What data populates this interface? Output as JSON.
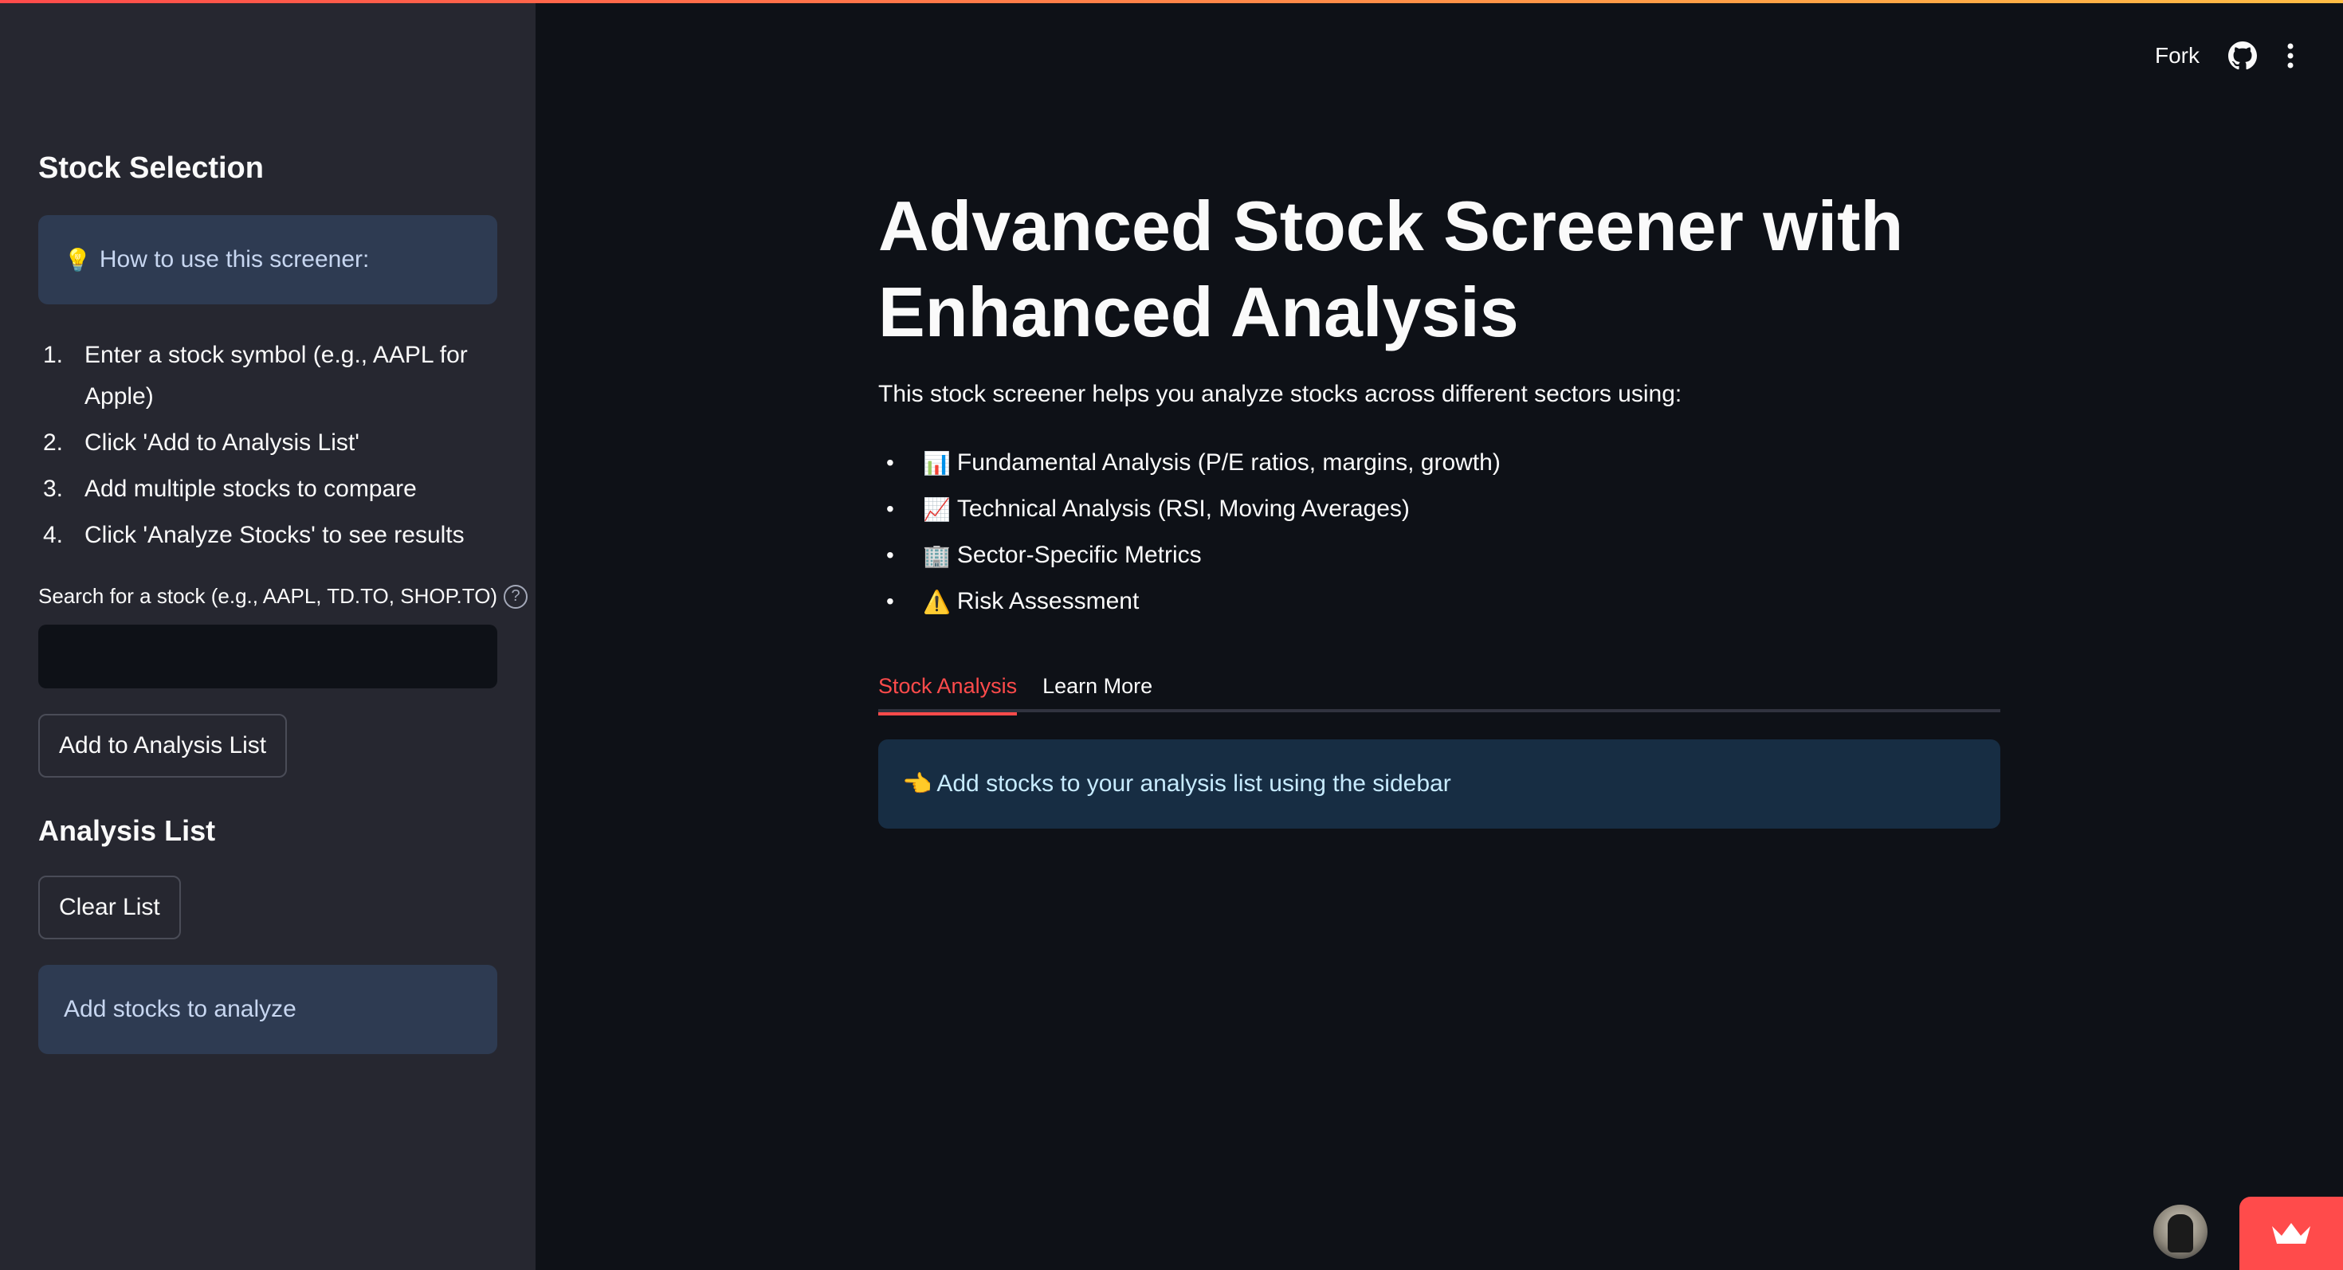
{
  "header": {
    "fork_label": "Fork",
    "github_icon": "github-icon",
    "menu_icon": "kebab-menu-icon"
  },
  "sidebar": {
    "title": "Stock Selection",
    "howto": {
      "icon": "💡",
      "text": "How to use this screener:"
    },
    "steps": [
      {
        "num": "1.",
        "text": "Enter a stock symbol (e.g., AAPL for Apple)"
      },
      {
        "num": "2.",
        "text": "Click 'Add to Analysis List'"
      },
      {
        "num": "3.",
        "text": "Add multiple stocks to compare"
      },
      {
        "num": "4.",
        "text": "Click 'Analyze Stocks' to see results"
      }
    ],
    "search": {
      "label": "Search for a stock (e.g., AAPL, TD.TO, SHOP.TO)",
      "help_icon": "?",
      "value": "",
      "placeholder": ""
    },
    "add_button": "Add to Analysis List",
    "analysis_list_title": "Analysis List",
    "clear_button": "Clear List",
    "empty_message": "Add stocks to analyze"
  },
  "main": {
    "title_line1": "Advanced Stock Screener with",
    "title_line2": "Enhanced Analysis",
    "intro": "This stock screener helps you analyze stocks across different sectors using:",
    "features": [
      {
        "bullet": "•",
        "icon": "📊",
        "text": "Fundamental Analysis (P/E ratios, margins, growth)"
      },
      {
        "bullet": "•",
        "icon": "📈",
        "text": "Technical Analysis (RSI, Moving Averages)"
      },
      {
        "bullet": "•",
        "icon": "🏢",
        "text": "Sector-Specific Metrics"
      },
      {
        "bullet": "•",
        "icon": "⚠️",
        "text": "Risk Assessment"
      }
    ],
    "tabs": [
      {
        "label": "Stock Analysis",
        "active": true
      },
      {
        "label": "Learn More",
        "active": false
      }
    ],
    "notice": {
      "icon": "👈",
      "text": "Add stocks to your analysis list using the sidebar"
    }
  },
  "colors": {
    "background": "#0e1117",
    "sidebar": "#262730",
    "accent": "#ff4b4b",
    "info_box": "#2e3b52",
    "notice_box": "#172d43"
  }
}
